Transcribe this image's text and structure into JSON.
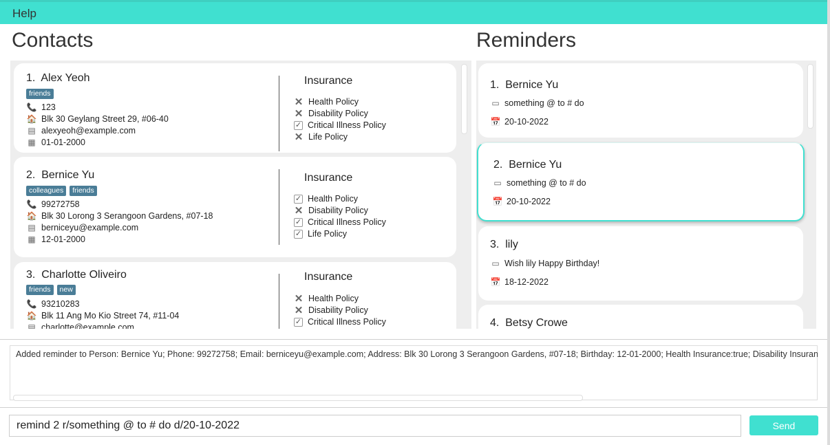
{
  "menu": {
    "help_label": "Help"
  },
  "contacts": {
    "title": "Contacts",
    "insurance_heading": "Insurance",
    "items": [
      {
        "index": "1.",
        "name": "Alex Yeoh",
        "tags": [
          "friends"
        ],
        "phone": "123",
        "address": "Blk 30 Geylang Street 29, #06-40",
        "email": "alexyeoh@example.com",
        "birthday": "01-01-2000",
        "policies": [
          {
            "label": "Health Policy",
            "status": "no"
          },
          {
            "label": "Disability Policy",
            "status": "no"
          },
          {
            "label": "Critical Illness Policy",
            "status": "yes"
          },
          {
            "label": "Life Policy",
            "status": "no"
          }
        ]
      },
      {
        "index": "2.",
        "name": "Bernice Yu",
        "tags": [
          "colleagues",
          "friends"
        ],
        "phone": "99272758",
        "address": "Blk 30 Lorong 3 Serangoon Gardens, #07-18",
        "email": "berniceyu@example.com",
        "birthday": "12-01-2000",
        "policies": [
          {
            "label": "Health Policy",
            "status": "yes"
          },
          {
            "label": "Disability Policy",
            "status": "no"
          },
          {
            "label": "Critical Illness Policy",
            "status": "yes"
          },
          {
            "label": "Life Policy",
            "status": "yes"
          }
        ]
      },
      {
        "index": "3.",
        "name": "Charlotte Oliveiro",
        "tags": [
          "friends",
          "new"
        ],
        "phone": "93210283",
        "address": "Blk 11 Ang Mo Kio Street 74, #11-04",
        "email": "charlotte@example.com",
        "policies": [
          {
            "label": "Health Policy",
            "status": "no"
          },
          {
            "label": "Disability Policy",
            "status": "no"
          },
          {
            "label": "Critical Illness Policy",
            "status": "yes"
          }
        ]
      }
    ]
  },
  "reminders": {
    "title": "Reminders",
    "items": [
      {
        "index": "1.",
        "name": "Bernice Yu",
        "task": "something @ to # do",
        "date": "20-10-2022"
      },
      {
        "index": "2.",
        "name": "Bernice Yu",
        "task": "something @ to # do",
        "date": "20-10-2022"
      },
      {
        "index": "3.",
        "name": "lily",
        "task": "Wish lily Happy Birthday!",
        "date": "18-12-2022"
      },
      {
        "index": "4.",
        "name": "Betsy Crowe"
      }
    ]
  },
  "result": {
    "text": "Added reminder to Person: Bernice Yu; Phone: 99272758; Email: berniceyu@example.com; Address: Blk 30 Lorong 3 Serangoon Gardens, #07-18; Birthday: 12-01-2000; Health Insurance:true; Disability Insuran"
  },
  "command": {
    "value": "remind 2 r/something @ to # do d/20-10-2022",
    "send_label": "Send"
  },
  "colors": {
    "accent": "#40e0d0",
    "tag": "#4a7d97",
    "panel": "#eeeeee"
  }
}
